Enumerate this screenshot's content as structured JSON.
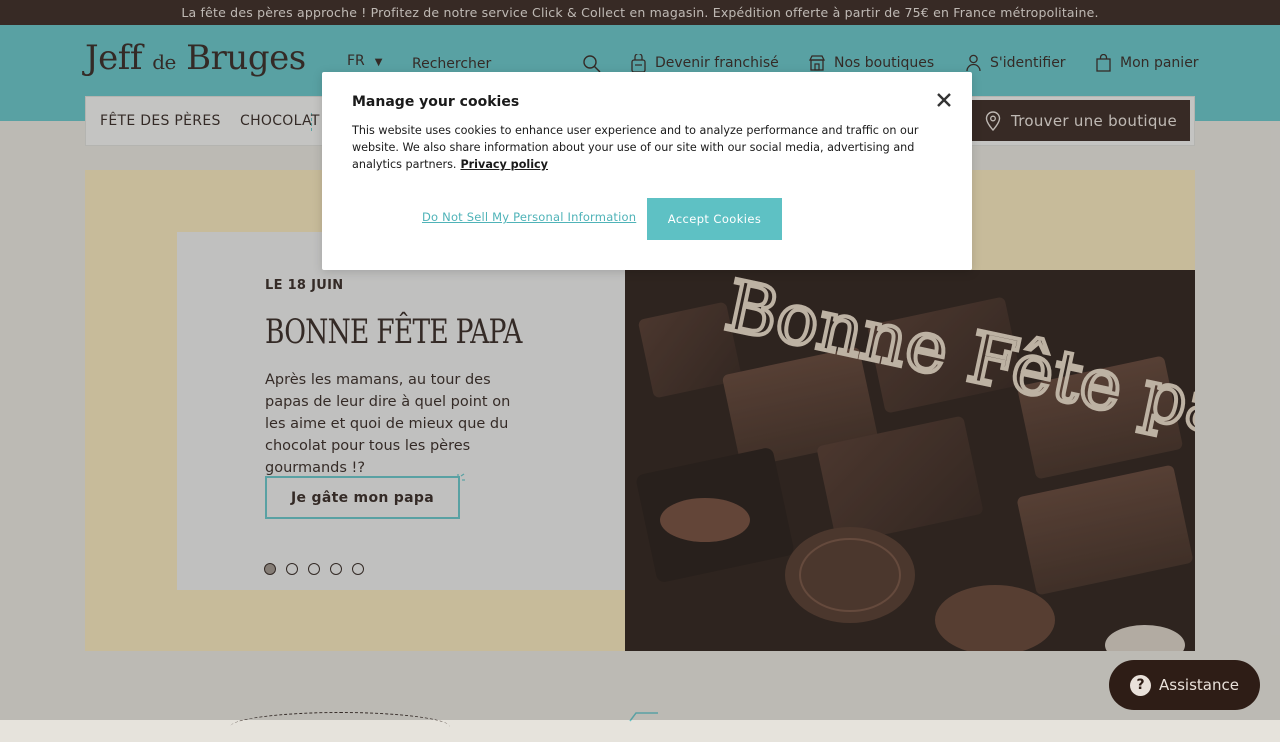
{
  "promo": {
    "text": "La fête des pères approche ! Profitez de notre service Click & Collect en magasin. Expédition offerte à partir de 75€ en France métropolitaine."
  },
  "header": {
    "logo": {
      "part1": "Jeff ",
      "part2": "de",
      "part3": " Bruges"
    },
    "lang": "FR",
    "search_placeholder": "Rechercher",
    "links": {
      "franchise": "Devenir franchisé",
      "stores": "Nos boutiques",
      "login": "S'identifier",
      "cart": "Mon panier"
    }
  },
  "nav": {
    "items": [
      "FÊTE DES PÈRES",
      "CHOCOLAT"
    ],
    "find_store": "Trouver une boutique"
  },
  "hero": {
    "eyebrow": "LE 18 JUIN",
    "title": "BONNE FÊTE PAPA",
    "text": "Après les mamans, au tour des papas de leur dire à quel point on les aime et quoi de mieux que du chocolat pour tous les pères gourmands !?",
    "cta": "Je gâte mon papa",
    "slides_count": 5,
    "active_slide": 1,
    "image_text": "Bonne Fête papa"
  },
  "cookies": {
    "title": "Manage your cookies",
    "text": "This website uses cookies to enhance user experience and to analyze performance and traffic on our website. We also share information about your use of our site with our social media, advertising and analytics partners.",
    "privacy_link": "Privacy policy",
    "do_not_sell": "Do Not Sell My Personal Information",
    "accept": "Accept Cookies"
  },
  "assistance": {
    "label": "Assistance",
    "icon": "?"
  },
  "colors": {
    "teal": "#5ec1c4",
    "dark": "#2e1d16",
    "cream": "#f6e5b8"
  }
}
